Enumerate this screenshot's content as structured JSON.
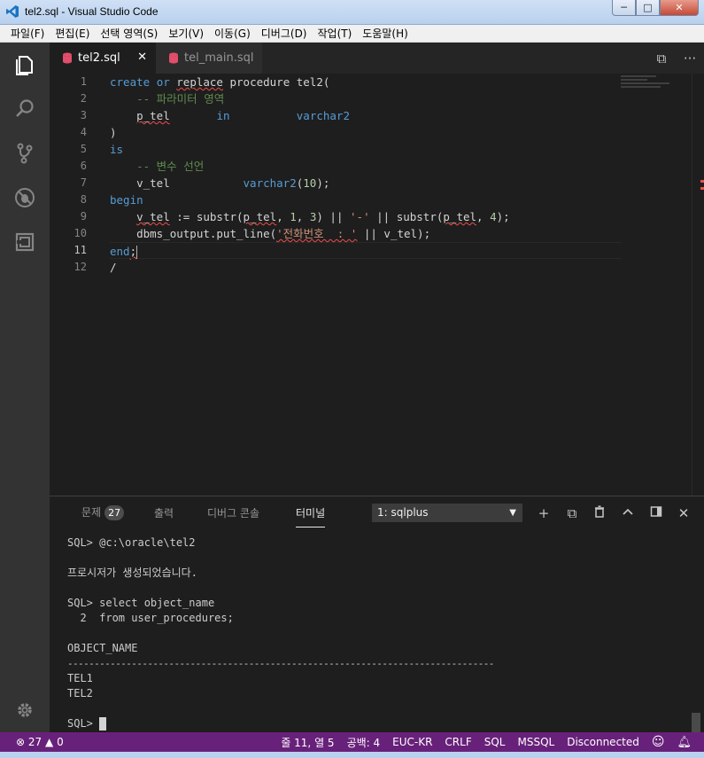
{
  "window": {
    "title": "tel2.sql - Visual Studio Code",
    "minimize": "─",
    "maximize": "□",
    "close": "✕"
  },
  "menu": [
    "파일(F)",
    "편집(E)",
    "선택 영역(S)",
    "보기(V)",
    "이동(G)",
    "디버그(D)",
    "작업(T)",
    "도움말(H)"
  ],
  "activity_bar": [
    "explorer-icon",
    "search-icon",
    "source-control-icon",
    "debug-icon",
    "extensions-icon",
    "settings-gear-icon"
  ],
  "tabs": [
    {
      "label": "tel2.sql",
      "active": true,
      "close": "✕"
    },
    {
      "label": "tel_main.sql",
      "active": false
    }
  ],
  "tab_actions": {
    "split": "⧉",
    "more": "···"
  },
  "editor": {
    "line_numbers": [
      "1",
      "2",
      "3",
      "4",
      "5",
      "6",
      "7",
      "8",
      "9",
      "10",
      "11",
      "12"
    ],
    "current_line": "11"
  },
  "panel": {
    "tabs": {
      "problems": "문제",
      "problems_count": "27",
      "output": "출력",
      "debug_console": "디버그 콘솔",
      "terminal": "터미널"
    },
    "terminal_select": "1: sqlplus",
    "terminal_lines": [
      "SQL> @c:\\oracle\\tel2",
      "",
      "프로시저가 생성되었습니다.",
      "",
      "SQL> select object_name",
      "  2  from user_procedures;",
      "",
      "OBJECT_NAME",
      "--------------------------------------------------------------------------------",
      "TEL1",
      "TEL2",
      "",
      "SQL> "
    ]
  },
  "status": {
    "errors": "27",
    "warnings": "0",
    "position": "줄 11, 열 5",
    "indent": "공백: 4",
    "encoding": "EUC-KR",
    "eol": "CRLF",
    "language": "SQL",
    "dialect": "MSSQL",
    "connection": "Disconnected"
  },
  "colors": {
    "status_bar": "#68217a",
    "activity_bar": "#333333",
    "editor_bg": "#1e1e1e",
    "keyword": "#569cd6",
    "comment": "#608b4e",
    "string": "#ce9178",
    "number": "#b5cea8"
  }
}
